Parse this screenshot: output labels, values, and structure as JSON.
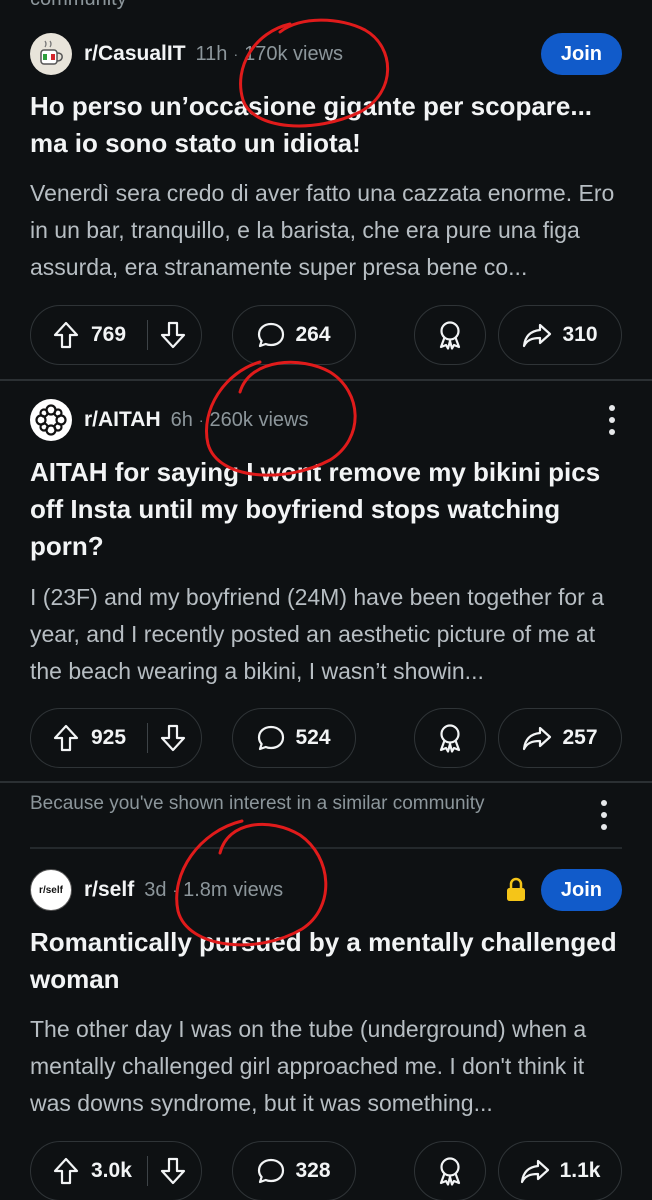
{
  "cutoff_text": "community",
  "posts": [
    {
      "subreddit": "r/CasualIT",
      "age": "11h",
      "separator": "·",
      "views": "170k views",
      "join_label": "Join",
      "title": "Ho perso un’occasione gigante per scopare... ma io sono stato un idiota!",
      "body": "Venerdì sera credo di aver fatto una cazzata enorme. Ero in un bar, tranquillo, e la barista, che era pure una figa assurda, era stranamente super presa bene co...",
      "upvotes": "769",
      "comments": "264",
      "shares": "310"
    },
    {
      "subreddit": "r/AITAH",
      "age": "6h",
      "separator": "·",
      "views": "260k views",
      "title": "AITAH for saying I wont remove my bikini pics off Insta until my boyfriend stops watching porn?",
      "body": "I (23F) and my boyfriend (24M) have been together for a year, and I recently posted an aesthetic picture of me at the beach wearing a bikini, I wasn’t showin...",
      "upvotes": "925",
      "comments": "524",
      "shares": "257"
    },
    {
      "recommendation": "Because you've shown interest in a similar community",
      "subreddit": "r/self",
      "avatar_text": "r/self",
      "age": "3d",
      "separator": "·",
      "views": "1.8m views",
      "join_label": "Join",
      "title": "Romantically pursued by a mentally challenged woman",
      "body": "The other day I was on the tube (underground) when a mentally challenged girl approached me. I don't think it was downs syndrome, but it was something...",
      "upvotes": "3.0k",
      "comments": "328",
      "shares": "1.1k"
    }
  ],
  "colors": {
    "background": "#0e1113",
    "join_button": "#115bca",
    "annotation": "#e01b1b",
    "lock": "#f5c518"
  }
}
